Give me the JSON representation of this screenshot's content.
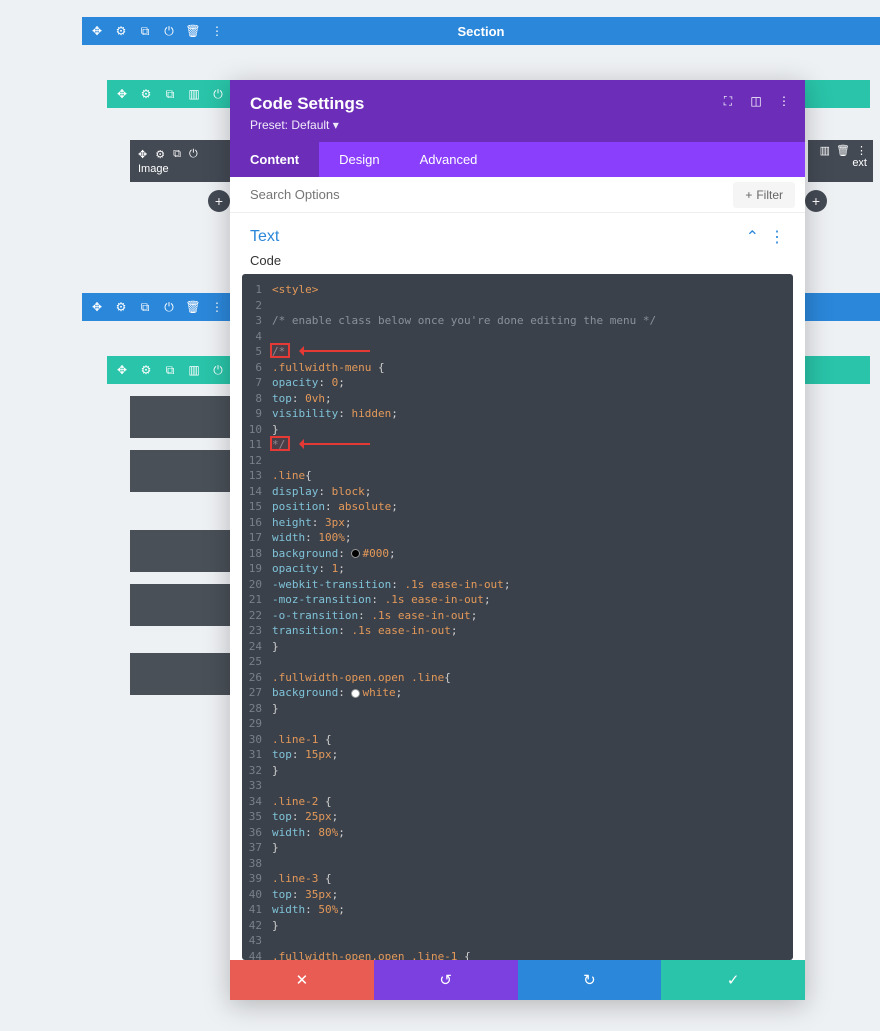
{
  "section": {
    "label": "Section"
  },
  "module_left": {
    "label": "Image"
  },
  "module_right": {
    "label": "ext"
  },
  "modal": {
    "title": "Code Settings",
    "preset": "Preset: Default",
    "tabs": {
      "content": "Content",
      "design": "Design",
      "advanced": "Advanced"
    },
    "search_placeholder": "Search Options",
    "filter": "Filter",
    "section_title": "Text",
    "code_label": "Code"
  },
  "code_lines": [
    "<style>",
    "",
    "/* enable class below once you're done editing the menu */",
    "",
    "/*",
    ".fullwidth-menu {",
    "opacity: 0;",
    "top: 0vh;",
    "visibility: hidden;",
    "}",
    "*/",
    "",
    ".line{",
    "display: block;",
    "position: absolute;",
    "height: 3px;",
    "width: 100%;",
    "background: #000;",
    "opacity: 1;",
    "-webkit-transition: .1s ease-in-out;",
    "-moz-transition: .1s ease-in-out;",
    "-o-transition: .1s ease-in-out;",
    "transition: .1s ease-in-out;",
    "}",
    "",
    ".fullwidth-open.open .line{",
    "background: white;",
    "}",
    "",
    ".line-1 {",
    "top: 15px;",
    "}",
    "",
    ".line-2 {",
    "top: 25px;",
    "width: 80%;",
    "}",
    "",
    ".line-3 {",
    "top: 35px;",
    "width: 50%;",
    "}",
    "",
    ".fullwidth-open.open .line-1 {"
  ],
  "annotations": {
    "box1_line": 5,
    "box2_line": 11
  }
}
